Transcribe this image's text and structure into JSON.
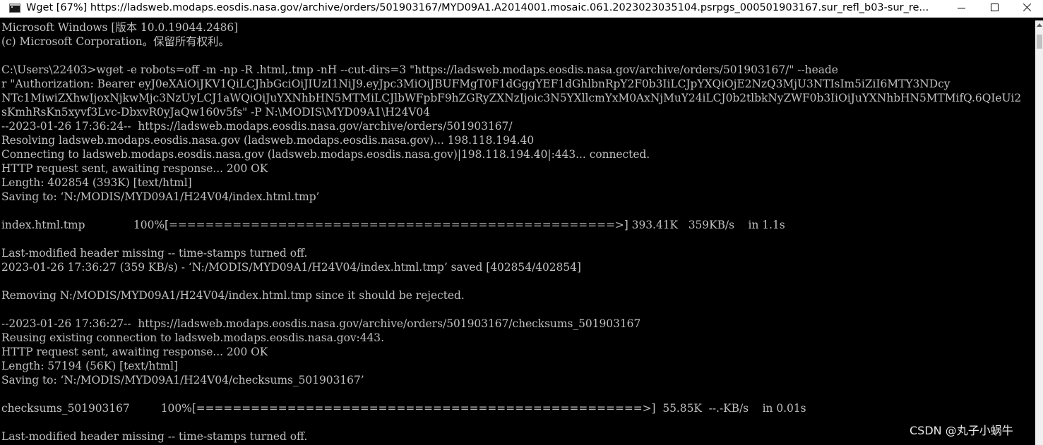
{
  "window": {
    "icon": "console-icon",
    "title": "Wget [67%] https://ladsweb.modaps.eosdis.nasa.gov/archive/orders/501903167/MYD09A1.A2014001.mosaic.061.2023023035104.psrpgs_000501903167.sur_refl_b03-sur_re..."
  },
  "console": {
    "lines": [
      "Microsoft Windows [版本 10.0.19044.2486]",
      "(c) Microsoft Corporation。保留所有权利。",
      "",
      "C:\\Users\\22403>wget -e robots=off -m -np -R .html,.tmp -nH --cut-dirs=3 \"https://ladsweb.modaps.eosdis.nasa.gov/archive/orders/501903167/\" --heade",
      "r \"Authorization: Bearer eyJ0eXAiOiJKV1QiLCJhbGciOiJIUzI1NiJ9.eyJpc3MiOiJBUFMgT0F1dGggYEF1dGhlbnRpY2F0b3IiLCJpYXQiOjE2NzQ3MjU3NTIsIm5iZiI6MTY3NDcy",
      "NTc1MiwiZXhwIjoxNjkwMjc3NzUyLCJ1aWQiOiJuYXNhbHN5MTMiLCJlbWFpbF9hZGRyZXNzIjoic3N5YXllcmYxM0AxNjMuY24iLCJ0b2tlbkNyZWF0b3IiOiJuYXNhbHN5MTMifQ.6QIeUi2",
      "sKmhRsKn5xyvf3Lvc-DbxvR0yJaQw160v5fs\" -P N:\\MODIS\\MYD09A1\\H24V04",
      "--2023-01-26 17:36:24--  https://ladsweb.modaps.eosdis.nasa.gov/archive/orders/501903167/",
      "Resolving ladsweb.modaps.eosdis.nasa.gov (ladsweb.modaps.eosdis.nasa.gov)... 198.118.194.40",
      "Connecting to ladsweb.modaps.eosdis.nasa.gov (ladsweb.modaps.eosdis.nasa.gov)|198.118.194.40|:443... connected.",
      "HTTP request sent, awaiting response... 200 OK",
      "Length: 402854 (393K) [text/html]",
      "Saving to: ‘N:/MODIS/MYD09A1/H24V04/index.html.tmp’",
      "",
      "index.html.tmp              100%[=================================================>] 393.41K   359KB/s    in 1.1s",
      "",
      "Last-modified header missing -- time-stamps turned off.",
      "2023-01-26 17:36:27 (359 KB/s) - ‘N:/MODIS/MYD09A1/H24V04/index.html.tmp’ saved [402854/402854]",
      "",
      "Removing N:/MODIS/MYD09A1/H24V04/index.html.tmp since it should be rejected.",
      "",
      "--2023-01-26 17:36:27--  https://ladsweb.modaps.eosdis.nasa.gov/archive/orders/501903167/checksums_501903167",
      "Reusing existing connection to ladsweb.modaps.eosdis.nasa.gov:443.",
      "HTTP request sent, awaiting response... 200 OK",
      "Length: 57194 (56K) [text/html]",
      "Saving to: ‘N:/MODIS/MYD09A1/H24V04/checksums_501903167’",
      "",
      "checksums_501903167         100%[=================================================>]  55.85K  --.-KB/s    in 0.01s",
      "",
      "Last-modified header missing -- time-stamps turned off."
    ]
  },
  "watermark": "CSDN @丸子小蜗牛"
}
